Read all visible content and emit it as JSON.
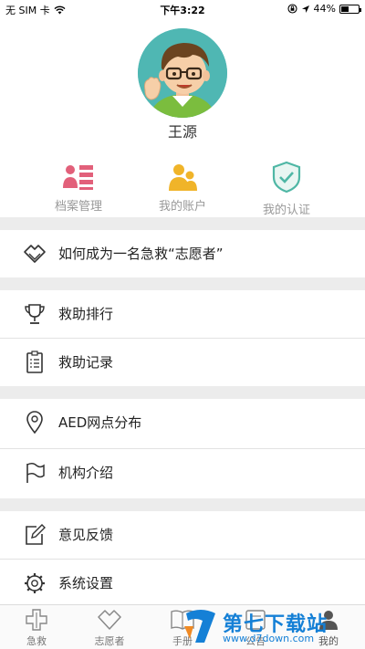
{
  "status_bar": {
    "carrier": "无 SIM 卡",
    "time": "下午3:22",
    "battery": "44%",
    "battery_level": 0.44
  },
  "profile": {
    "username": "王源"
  },
  "quick_entries": [
    {
      "label": "档案管理",
      "icon": "archive-icon",
      "color": "#e2607a"
    },
    {
      "label": "我的账户",
      "icon": "users-icon",
      "color": "#f0b429"
    },
    {
      "label": "我的认证",
      "icon": "shield-check-icon",
      "color": "#4fb7a5"
    }
  ],
  "menu": {
    "volunteer_guide": "如何成为一名急救“志愿者”",
    "rescue_ranking": "救助排行",
    "rescue_records": "救助记录",
    "aed_distribution": "AED网点分布",
    "organization_intro": "机构介绍",
    "feedback": "意见反馈",
    "settings": "系统设置"
  },
  "tabbar": {
    "tabs": [
      {
        "label": "急救",
        "icon": "first-aid-icon"
      },
      {
        "label": "志愿者",
        "icon": "heart-hands-icon"
      },
      {
        "label": "手册",
        "icon": "book-icon"
      },
      {
        "label": "公告",
        "icon": "announcement-icon"
      },
      {
        "label": "我的",
        "icon": "profile-icon"
      }
    ]
  },
  "watermark": {
    "title": "第七下载站",
    "url": "www.d7down.com"
  }
}
